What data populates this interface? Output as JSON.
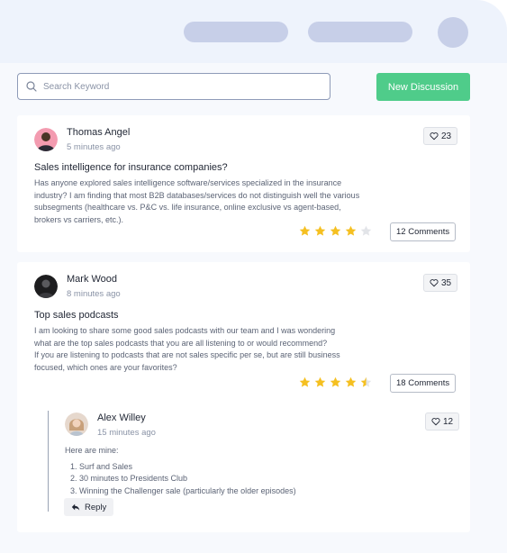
{
  "header": {
    "nav_placeholders": 2,
    "avatar": "user-avatar"
  },
  "search": {
    "placeholder": "Search Keyword",
    "icon": "search-icon"
  },
  "new_discussion_label": "New Discussion",
  "colors": {
    "accent": "#4fcc8a",
    "star": "#f5c021",
    "star_empty": "#e2e4e8",
    "page_bg": "#f7f9fd"
  },
  "posts": [
    {
      "author": "Thomas Angel",
      "time": "5 minutes ago",
      "title": "Sales intelligence for insurance companies?",
      "body_lines": [
        "Has anyone explored sales intelligence software/services specialized in the insurance",
        "industry? I am finding that most B2B databases/services do not distinguish well the various",
        "subsegments (healthcare vs. P&C vs. life insurance, online exclusive vs agent-based,",
        "brokers vs carriers, etc.)."
      ],
      "likes": "23",
      "comments_label": "12 Comments",
      "rating": 4
    },
    {
      "author": "Mark Wood",
      "time": "8 minutes ago",
      "title": "Top sales podcasts",
      "body_lines": [
        "I am looking to share some good sales podcasts with our team and I was wondering",
        "what are the top sales podcasts that you are all listening to or would recommend?",
        "If you are listening to podcasts that are not sales specific per se, but are still business",
        "focused, which ones are your favorites?"
      ],
      "likes": "35",
      "comments_label": "18 Comments",
      "rating": 4.5,
      "reply": {
        "author": "Alex Willey",
        "time": "15 minutes ago",
        "intro": "Here are mine:",
        "items": [
          "Surf and Sales",
          "30 minutes to Presidents Club",
          "Winning the Challenger sale (particularly the older episodes)"
        ],
        "likes": "12",
        "reply_label": "Reply"
      }
    }
  ]
}
